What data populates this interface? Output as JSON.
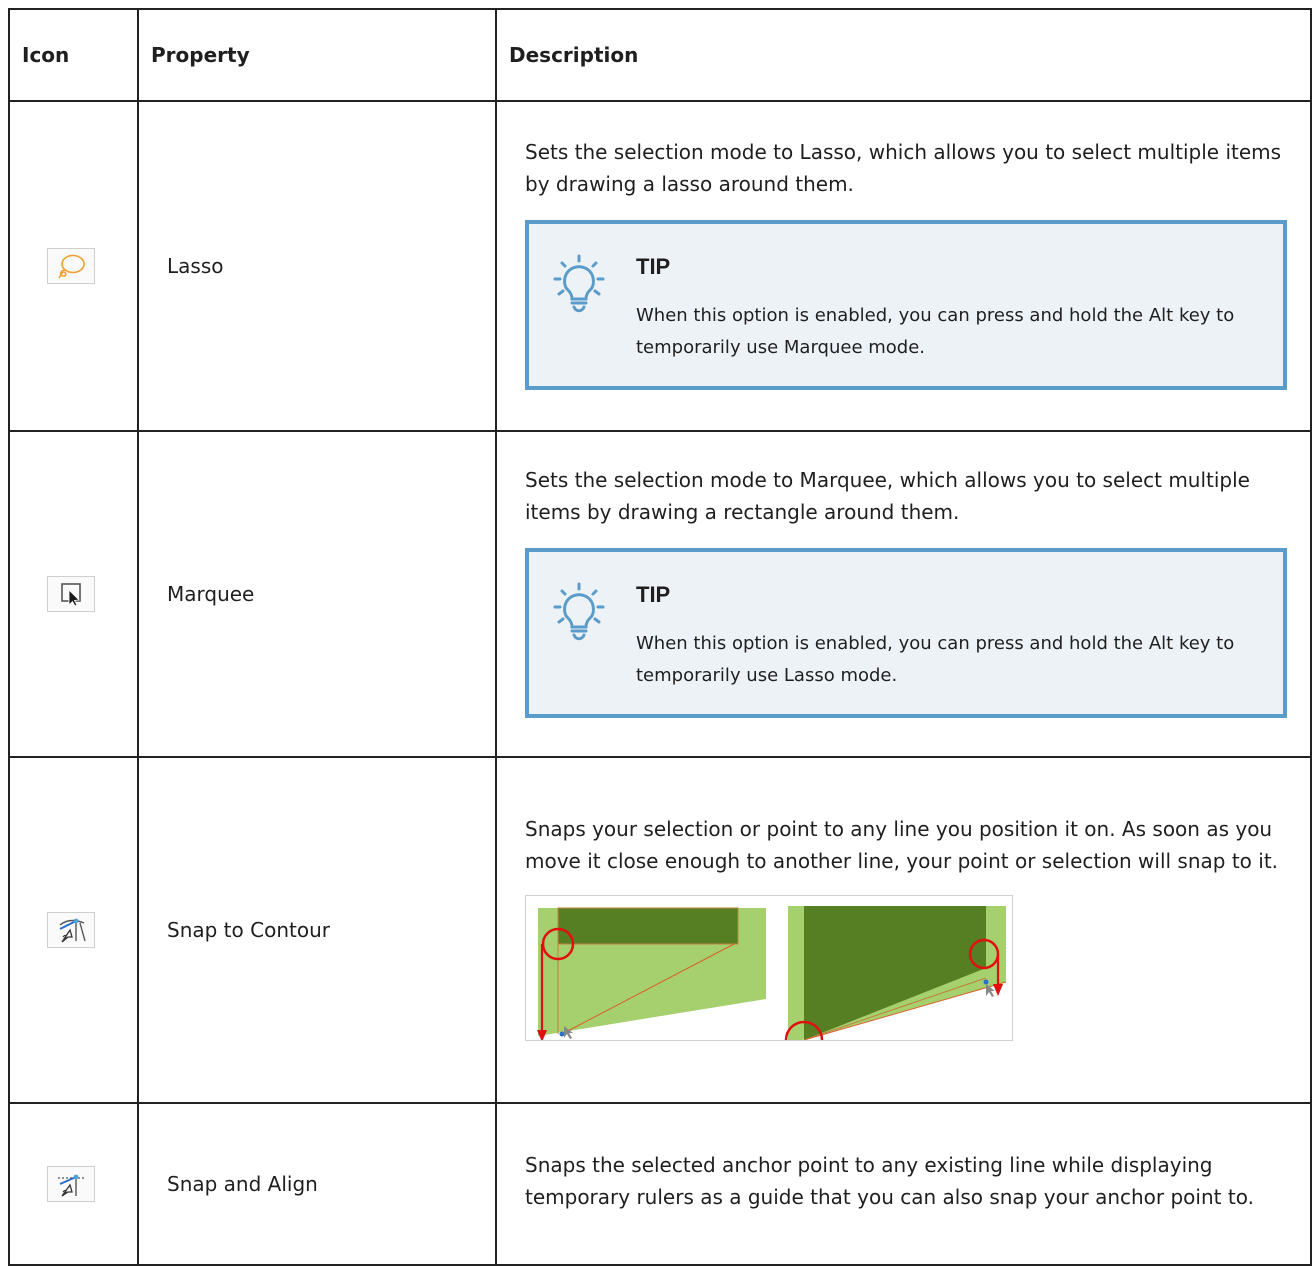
{
  "table": {
    "headers": {
      "icon": "Icon",
      "property": "Property",
      "description": "Description"
    },
    "rows": [
      {
        "icon": "lasso-icon",
        "property": "Lasso",
        "description": "Sets the selection mode to Lasso, which allows you to select multiple items by drawing a lasso around them.",
        "tip": {
          "title": "TIP",
          "text": "When this option is enabled, you can press and hold the Alt key to temporarily use Marquee mode."
        }
      },
      {
        "icon": "marquee-icon",
        "property": "Marquee",
        "description": "Sets the selection mode to Marquee, which allows you to select multiple items by drawing a rectangle around them.",
        "tip": {
          "title": "TIP",
          "text": "When this option is enabled, you can press and hold the Alt key to temporarily use Lasso mode."
        }
      },
      {
        "icon": "snap-to-contour-icon",
        "property": "Snap to Contour",
        "description": "Snaps your selection or point to any line you position it on. As soon as you move it close enough to another line, your point or selection will snap to it.",
        "figure": "snap-to-contour-illustration"
      },
      {
        "icon": "snap-and-align-icon",
        "property": "Snap and Align",
        "description": "Snaps the selected anchor point to any existing line while displaying temporary rulers as a guide that you can also snap your anchor point to."
      }
    ]
  },
  "colors": {
    "tip_border": "#5b9bc9",
    "tip_background": "#edf2f7",
    "lasso_orange": "#f0a030",
    "figure_light_green": "#a6cf6e",
    "figure_dark_green": "#567f24",
    "figure_red": "#e01010"
  }
}
